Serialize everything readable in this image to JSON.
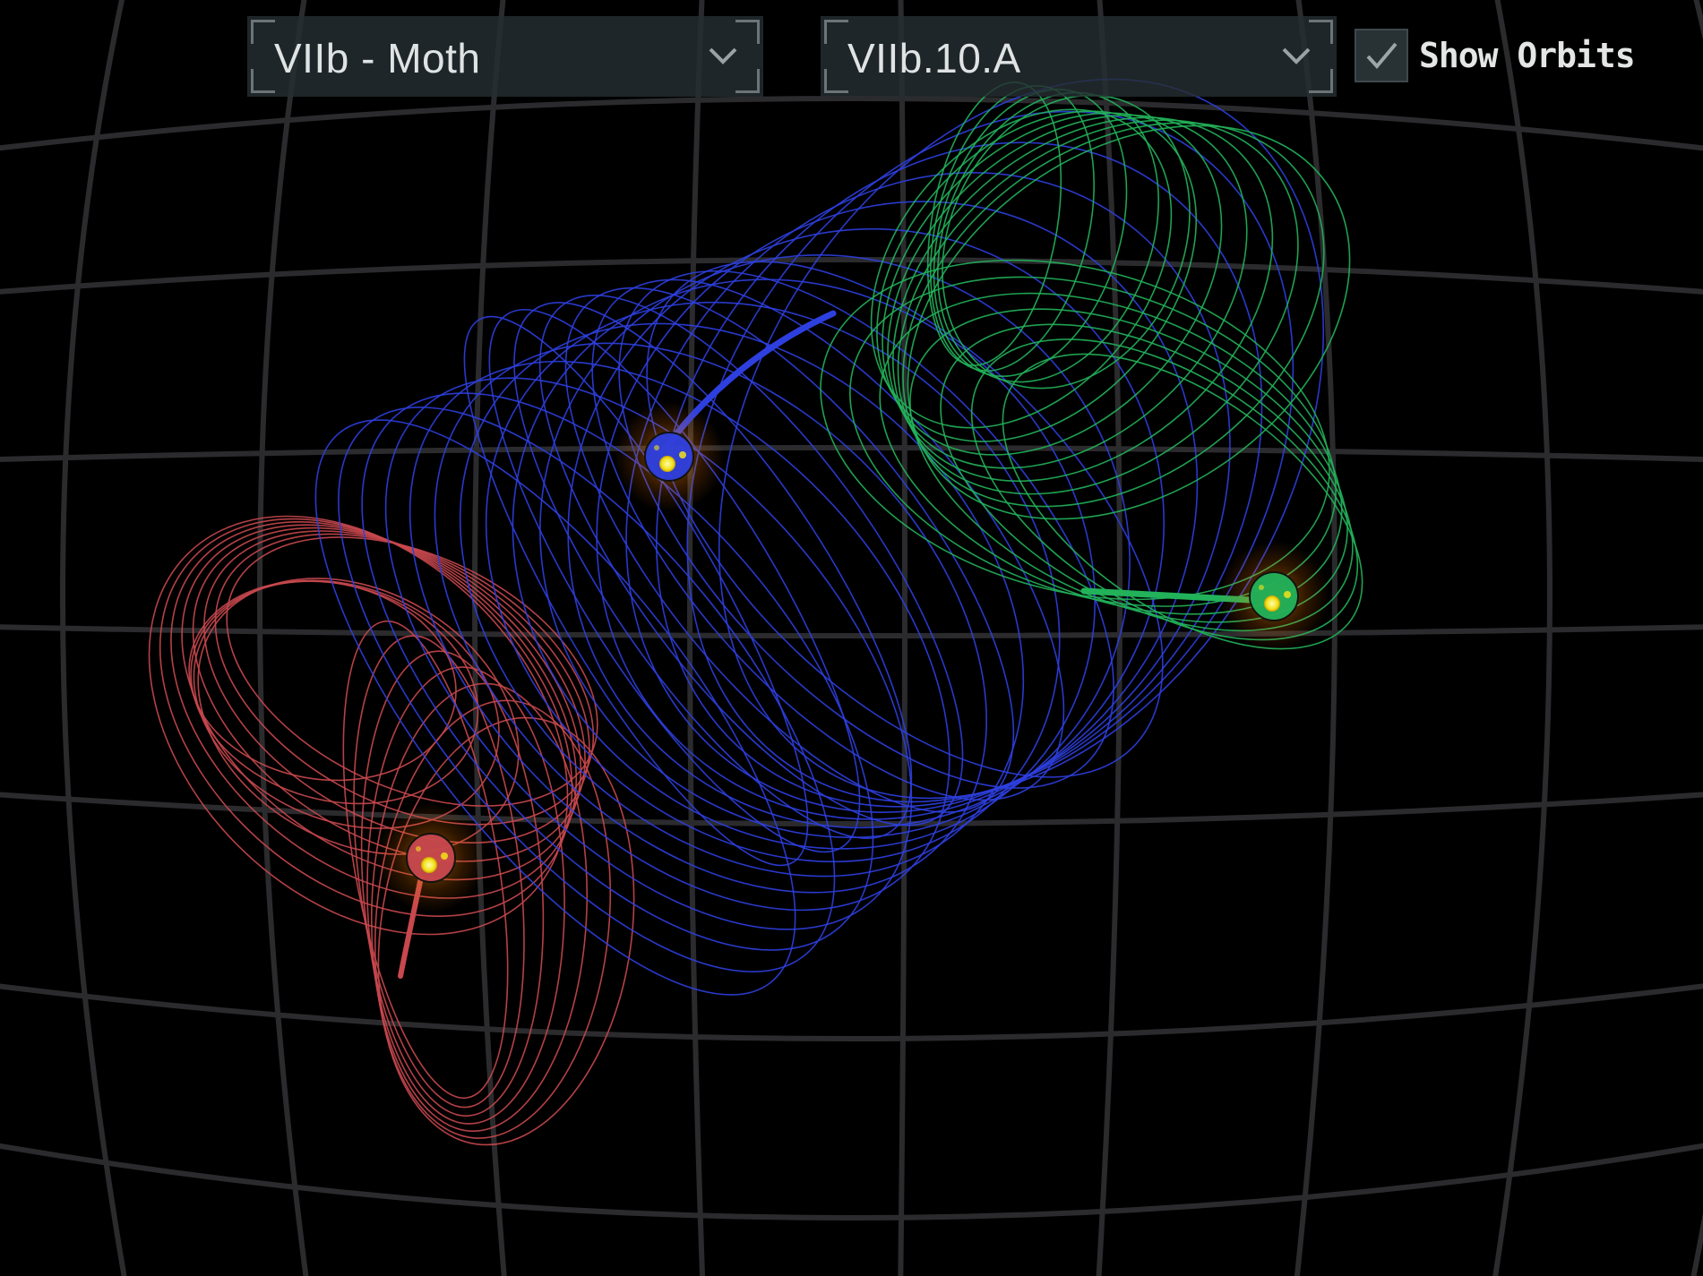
{
  "toolbar": {
    "system_dropdown": {
      "selected": "VIIb - Moth"
    },
    "variant_dropdown": {
      "selected": "VIIb.10.A"
    },
    "show_orbits": {
      "label": "Show Orbits",
      "checked": true
    }
  },
  "scene": {
    "background_color": "#000000",
    "grid_color": "#2b2b2e",
    "bodies": [
      {
        "name": "blue-body",
        "orbit_color": "#2e3fe0",
        "core_color": "#f2e21a"
      },
      {
        "name": "green-body",
        "orbit_color": "#22b25a",
        "core_color": "#f2e21a"
      },
      {
        "name": "red-body",
        "orbit_color": "#c8484e",
        "core_color": "#f2e21a"
      }
    ]
  }
}
